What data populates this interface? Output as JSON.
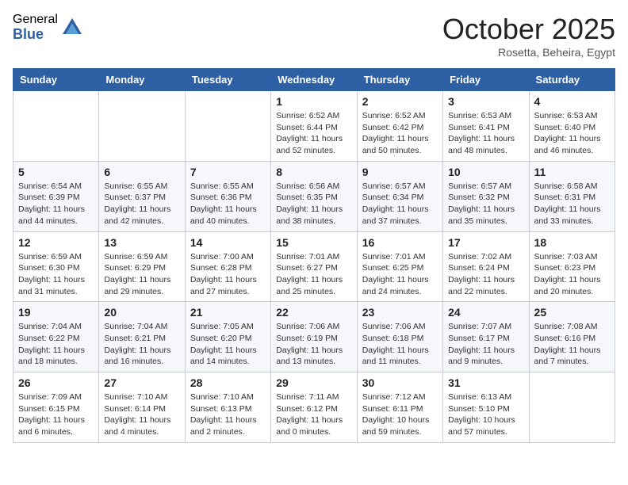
{
  "logo": {
    "general": "General",
    "blue": "Blue"
  },
  "title": "October 2025",
  "location": "Rosetta, Beheira, Egypt",
  "weekdays": [
    "Sunday",
    "Monday",
    "Tuesday",
    "Wednesday",
    "Thursday",
    "Friday",
    "Saturday"
  ],
  "weeks": [
    [
      {
        "day": "",
        "info": ""
      },
      {
        "day": "",
        "info": ""
      },
      {
        "day": "",
        "info": ""
      },
      {
        "day": "1",
        "info": "Sunrise: 6:52 AM\nSunset: 6:44 PM\nDaylight: 11 hours\nand 52 minutes."
      },
      {
        "day": "2",
        "info": "Sunrise: 6:52 AM\nSunset: 6:42 PM\nDaylight: 11 hours\nand 50 minutes."
      },
      {
        "day": "3",
        "info": "Sunrise: 6:53 AM\nSunset: 6:41 PM\nDaylight: 11 hours\nand 48 minutes."
      },
      {
        "day": "4",
        "info": "Sunrise: 6:53 AM\nSunset: 6:40 PM\nDaylight: 11 hours\nand 46 minutes."
      }
    ],
    [
      {
        "day": "5",
        "info": "Sunrise: 6:54 AM\nSunset: 6:39 PM\nDaylight: 11 hours\nand 44 minutes."
      },
      {
        "day": "6",
        "info": "Sunrise: 6:55 AM\nSunset: 6:37 PM\nDaylight: 11 hours\nand 42 minutes."
      },
      {
        "day": "7",
        "info": "Sunrise: 6:55 AM\nSunset: 6:36 PM\nDaylight: 11 hours\nand 40 minutes."
      },
      {
        "day": "8",
        "info": "Sunrise: 6:56 AM\nSunset: 6:35 PM\nDaylight: 11 hours\nand 38 minutes."
      },
      {
        "day": "9",
        "info": "Sunrise: 6:57 AM\nSunset: 6:34 PM\nDaylight: 11 hours\nand 37 minutes."
      },
      {
        "day": "10",
        "info": "Sunrise: 6:57 AM\nSunset: 6:32 PM\nDaylight: 11 hours\nand 35 minutes."
      },
      {
        "day": "11",
        "info": "Sunrise: 6:58 AM\nSunset: 6:31 PM\nDaylight: 11 hours\nand 33 minutes."
      }
    ],
    [
      {
        "day": "12",
        "info": "Sunrise: 6:59 AM\nSunset: 6:30 PM\nDaylight: 11 hours\nand 31 minutes."
      },
      {
        "day": "13",
        "info": "Sunrise: 6:59 AM\nSunset: 6:29 PM\nDaylight: 11 hours\nand 29 minutes."
      },
      {
        "day": "14",
        "info": "Sunrise: 7:00 AM\nSunset: 6:28 PM\nDaylight: 11 hours\nand 27 minutes."
      },
      {
        "day": "15",
        "info": "Sunrise: 7:01 AM\nSunset: 6:27 PM\nDaylight: 11 hours\nand 25 minutes."
      },
      {
        "day": "16",
        "info": "Sunrise: 7:01 AM\nSunset: 6:25 PM\nDaylight: 11 hours\nand 24 minutes."
      },
      {
        "day": "17",
        "info": "Sunrise: 7:02 AM\nSunset: 6:24 PM\nDaylight: 11 hours\nand 22 minutes."
      },
      {
        "day": "18",
        "info": "Sunrise: 7:03 AM\nSunset: 6:23 PM\nDaylight: 11 hours\nand 20 minutes."
      }
    ],
    [
      {
        "day": "19",
        "info": "Sunrise: 7:04 AM\nSunset: 6:22 PM\nDaylight: 11 hours\nand 18 minutes."
      },
      {
        "day": "20",
        "info": "Sunrise: 7:04 AM\nSunset: 6:21 PM\nDaylight: 11 hours\nand 16 minutes."
      },
      {
        "day": "21",
        "info": "Sunrise: 7:05 AM\nSunset: 6:20 PM\nDaylight: 11 hours\nand 14 minutes."
      },
      {
        "day": "22",
        "info": "Sunrise: 7:06 AM\nSunset: 6:19 PM\nDaylight: 11 hours\nand 13 minutes."
      },
      {
        "day": "23",
        "info": "Sunrise: 7:06 AM\nSunset: 6:18 PM\nDaylight: 11 hours\nand 11 minutes."
      },
      {
        "day": "24",
        "info": "Sunrise: 7:07 AM\nSunset: 6:17 PM\nDaylight: 11 hours\nand 9 minutes."
      },
      {
        "day": "25",
        "info": "Sunrise: 7:08 AM\nSunset: 6:16 PM\nDaylight: 11 hours\nand 7 minutes."
      }
    ],
    [
      {
        "day": "26",
        "info": "Sunrise: 7:09 AM\nSunset: 6:15 PM\nDaylight: 11 hours\nand 6 minutes."
      },
      {
        "day": "27",
        "info": "Sunrise: 7:10 AM\nSunset: 6:14 PM\nDaylight: 11 hours\nand 4 minutes."
      },
      {
        "day": "28",
        "info": "Sunrise: 7:10 AM\nSunset: 6:13 PM\nDaylight: 11 hours\nand 2 minutes."
      },
      {
        "day": "29",
        "info": "Sunrise: 7:11 AM\nSunset: 6:12 PM\nDaylight: 11 hours\nand 0 minutes."
      },
      {
        "day": "30",
        "info": "Sunrise: 7:12 AM\nSunset: 6:11 PM\nDaylight: 10 hours\nand 59 minutes."
      },
      {
        "day": "31",
        "info": "Sunrise: 6:13 AM\nSunset: 5:10 PM\nDaylight: 10 hours\nand 57 minutes."
      },
      {
        "day": "",
        "info": ""
      }
    ]
  ]
}
